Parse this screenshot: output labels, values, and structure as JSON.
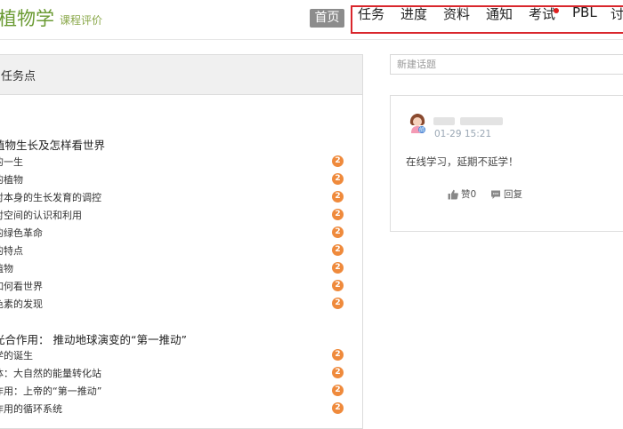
{
  "header": {
    "course_title": "植物学",
    "course_subtitle": "课程评价",
    "home_label": "首页",
    "nav": [
      "任务",
      "进度",
      "资料",
      "通知",
      "考试",
      "PBL",
      "讨"
    ],
    "accent_color": "#d9262c"
  },
  "task_panel": {
    "title": "任务点",
    "chapters": [
      {
        "title": "植物生长及怎样看世界",
        "lessons": [
          {
            "label": "的一生",
            "badge": "2"
          },
          {
            "label": "的植物",
            "badge": "2"
          },
          {
            "label": "对本身的生长发育的调控",
            "badge": "2"
          },
          {
            "label": "对空间的认识和利用",
            "badge": "2"
          },
          {
            "label": "的绿色革命",
            "badge": "2"
          },
          {
            "label": "的特点",
            "badge": "2"
          },
          {
            "label": "植物",
            "badge": "2"
          },
          {
            "label": "如何看世界",
            "badge": "2"
          },
          {
            "label": "色素的发现",
            "badge": "2"
          }
        ]
      },
      {
        "title": "光合作用：  推动地球演变的“第一推动”",
        "lessons": [
          {
            "label": "学的诞生",
            "badge": "2"
          },
          {
            "label": "体：大自然的能量转化站",
            "badge": "2"
          },
          {
            "label": "作用：上帝的“第一推动”",
            "badge": "2"
          },
          {
            "label": "作用的循环系统",
            "badge": "2"
          }
        ]
      }
    ]
  },
  "discussion": {
    "new_topic_placeholder": "新建话题",
    "post": {
      "time": "01-29 15:21",
      "content": "在线学习，延期不延学！",
      "like_label": "赞0",
      "reply_label": "回复"
    }
  }
}
